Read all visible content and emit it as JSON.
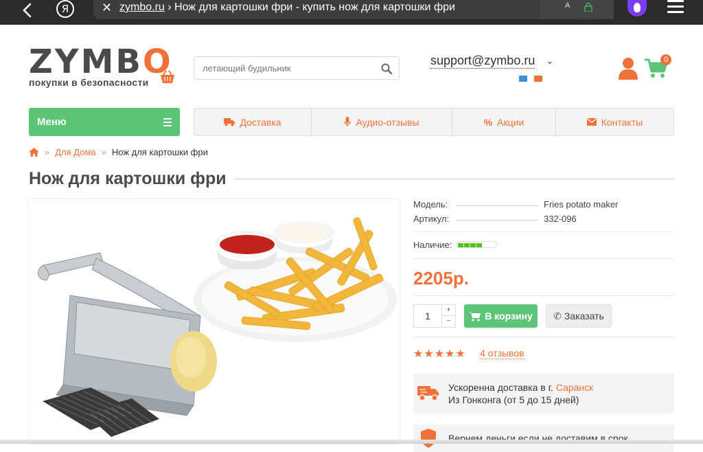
{
  "browser": {
    "url_domain": "zymbo.ru",
    "url_rest": " › Нож для картошки фри - купить нож для картошки фри",
    "yandex_letter": "Я",
    "reader_label": "A"
  },
  "header": {
    "logo_word_left": "ZYMB",
    "logo_word_o": "O",
    "logo_tagline": "покупки в безопасности",
    "search_placeholder": "летающий будильник",
    "support_email": "support@zymbo.ru",
    "cart_count": "0"
  },
  "nav": {
    "menu_label": "Меню",
    "items": [
      {
        "label": "Доставка",
        "icon": "truck-icon"
      },
      {
        "label": "Аудио-отзывы",
        "icon": "microphone-icon"
      },
      {
        "label": "Акции",
        "icon": "percent-icon"
      },
      {
        "label": "Контакты",
        "icon": "envelope-icon"
      }
    ]
  },
  "breadcrumb": {
    "sep": "»",
    "category": "Для Дома",
    "current": "Нож для картошки фри"
  },
  "product": {
    "title": "Нож для картошки фри",
    "model_label": "Модель:",
    "model_value": "Fries potato maker",
    "sku_label": "Артикул:",
    "sku_value": "332-096",
    "availability_label": "Наличие:",
    "availability_level": 0.6,
    "price": "2205р.",
    "quantity": "1",
    "qty_plus": "+",
    "qty_minus": "−",
    "add_to_cart": "В корзину",
    "order": "Заказать",
    "rating_stars": 5,
    "stars_text": "★★★★★",
    "reviews": "4 отзывов"
  },
  "delivery": {
    "line1_prefix": "Ускоренна доставка в г. ",
    "city": "Саранск",
    "line2": "Из Гонконга (от 5 до 15 дней)"
  },
  "guarantee": {
    "line1": "Вернем деньги если не доставим в срок"
  },
  "colors": {
    "accent_orange": "#f07238",
    "accent_green": "#5cc577",
    "availability_green": "#52c41a"
  }
}
